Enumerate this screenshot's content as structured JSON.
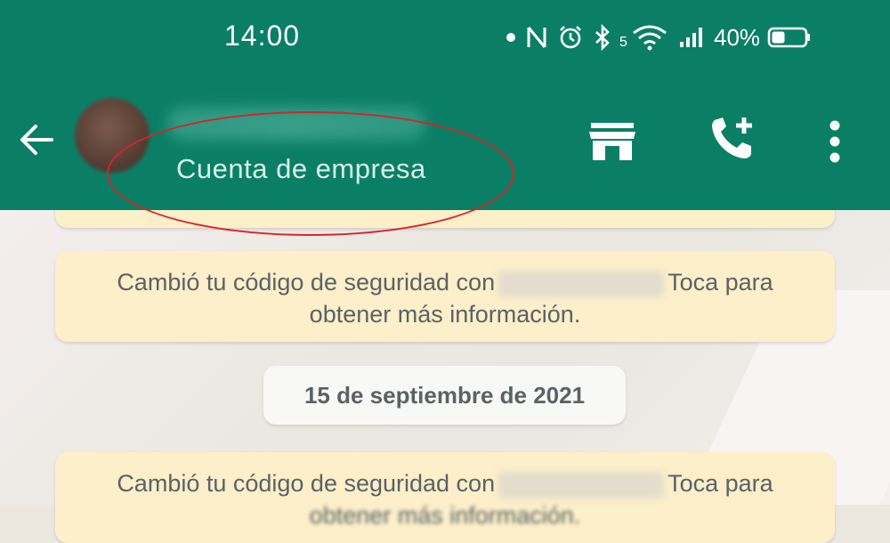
{
  "status_bar": {
    "time": "14:00",
    "battery_percent": "40%",
    "network_label": "5",
    "battery_level": 0.4
  },
  "header": {
    "subtitle": "Cuenta de empresa",
    "background_color": "#0b7f66",
    "annotation_color": "#d8232a"
  },
  "messages": [
    {
      "text_before": "Cambió tu código de seguridad con",
      "text_after": "Toca para",
      "line2": "obtener más información."
    },
    {
      "text_before": "Cambió tu código de seguridad con",
      "text_after": "Toca para",
      "line2": "obtener más información."
    }
  ],
  "date_divider": "15 de septiembre de 2021",
  "icons": [
    "back-arrow-icon",
    "store-icon",
    "add-call-icon",
    "more-vert-icon",
    "nfc-icon",
    "alarm-icon",
    "bluetooth-icon",
    "wifi-icon",
    "signal-icon",
    "battery-icon"
  ]
}
